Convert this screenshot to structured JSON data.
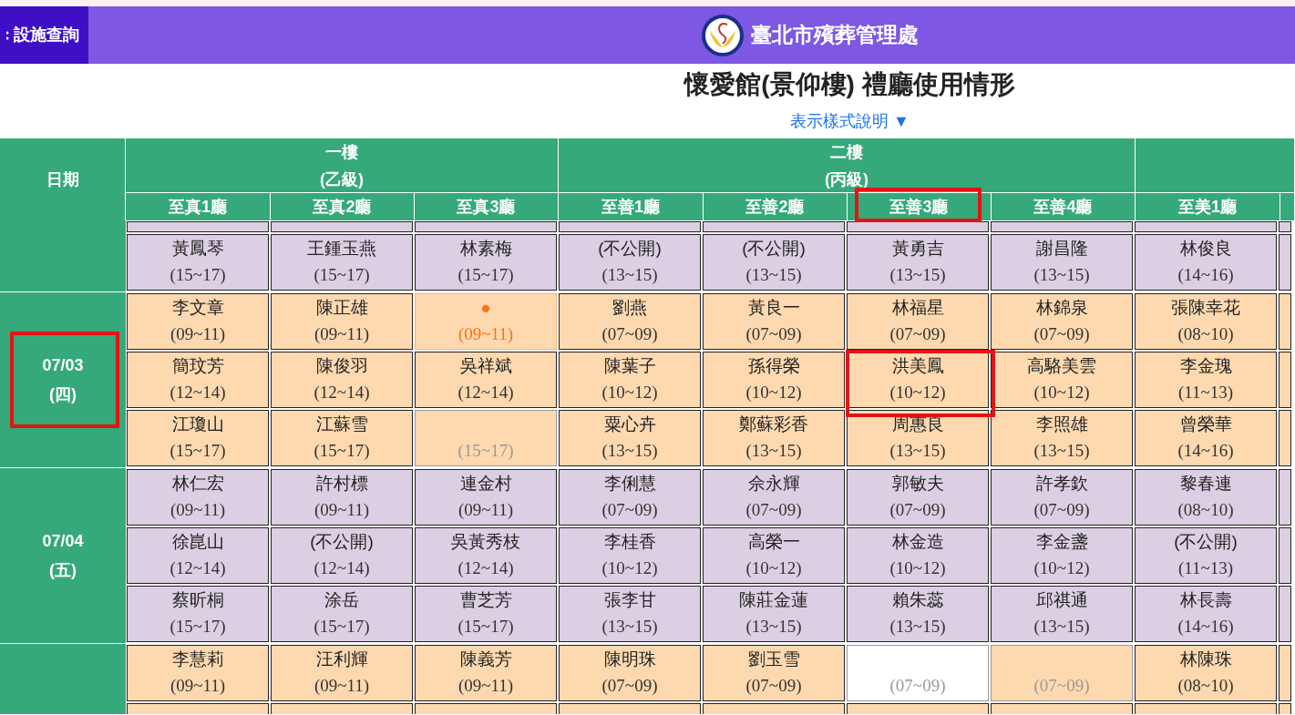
{
  "nav_button": {
    "label": "設施查詢"
  },
  "site_title": "臺北市殯葬管理處",
  "page_title": "懷愛館(景仰樓) 禮廳使用情形",
  "legend_link": "表示樣式說明 ▼",
  "table": {
    "date_heading": "日期",
    "floors": [
      {
        "name": "一樓",
        "grade": "(乙級)",
        "halls": [
          {
            "name": "至真1廳",
            "highlighted": false
          },
          {
            "name": "至真2廳",
            "highlighted": false
          },
          {
            "name": "至真3廳",
            "highlighted": false
          }
        ]
      },
      {
        "name": "二樓",
        "grade": "(丙級)",
        "halls": [
          {
            "name": "至善1廳",
            "highlighted": false
          },
          {
            "name": "至善2廳",
            "highlighted": false
          },
          {
            "name": "至善3廳",
            "highlighted": true
          },
          {
            "name": "至善4廳",
            "highlighted": false
          }
        ]
      },
      {
        "halls": [
          {
            "name": "至美1廳",
            "highlighted": false
          }
        ]
      }
    ],
    "days": [
      {
        "color": "#dccfe3",
        "highlighted": false,
        "rows": [
          [
            {
              "kind": "booked",
              "name": "黃鳳琴",
              "time": "(15~17)"
            },
            {
              "kind": "booked",
              "name": "王鍾玉燕",
              "time": "(15~17)"
            },
            {
              "kind": "booked",
              "name": "林素梅",
              "time": "(15~17)"
            },
            {
              "kind": "booked",
              "name": "(不公開)",
              "time": "(13~15)"
            },
            {
              "kind": "booked",
              "name": "(不公開)",
              "time": "(13~15)"
            },
            {
              "kind": "booked",
              "name": "黃勇吉",
              "time": "(13~15)"
            },
            {
              "kind": "booked",
              "name": "謝昌隆",
              "time": "(13~15)"
            },
            {
              "kind": "booked",
              "name": "林俊良",
              "time": "(14~16)"
            }
          ]
        ]
      },
      {
        "date": "07/03",
        "weekday": "(四)",
        "color": "#fed9b0",
        "highlighted": true,
        "rows": [
          [
            {
              "kind": "booked",
              "name": "李文章",
              "time": "(09~11)"
            },
            {
              "kind": "booked",
              "name": "陳正雄",
              "time": "(09~11)"
            },
            {
              "kind": "pending",
              "name": "●",
              "time": "(09~11)"
            },
            {
              "kind": "booked",
              "name": "劉燕",
              "time": "(07~09)"
            },
            {
              "kind": "booked",
              "name": "黃良一",
              "time": "(07~09)"
            },
            {
              "kind": "booked",
              "name": "林福星",
              "time": "(07~09)"
            },
            {
              "kind": "booked",
              "name": "林錦泉",
              "time": "(07~09)"
            },
            {
              "kind": "booked",
              "name": "張陳幸花",
              "time": "(08~10)"
            }
          ],
          [
            {
              "kind": "booked",
              "name": "簡玟芳",
              "time": "(12~14)"
            },
            {
              "kind": "booked",
              "name": "陳俊羽",
              "time": "(12~14)"
            },
            {
              "kind": "booked",
              "name": "吳祥斌",
              "time": "(12~14)"
            },
            {
              "kind": "booked",
              "name": "陳葉子",
              "time": "(10~12)"
            },
            {
              "kind": "booked",
              "name": "孫得榮",
              "time": "(10~12)"
            },
            {
              "kind": "booked",
              "name": "洪美鳳",
              "time": "(10~12)",
              "highlighted": true
            },
            {
              "kind": "booked",
              "name": "高駱美雲",
              "time": "(10~12)"
            },
            {
              "kind": "booked",
              "name": "李金瑰",
              "time": "(11~13)"
            }
          ],
          [
            {
              "kind": "booked",
              "name": "江瓊山",
              "time": "(15~17)"
            },
            {
              "kind": "booked",
              "name": "江蘇雪",
              "time": "(15~17)"
            },
            {
              "kind": "free",
              "time": "(15~17)"
            },
            {
              "kind": "booked",
              "name": "粟心卉",
              "time": "(13~15)"
            },
            {
              "kind": "booked",
              "name": "鄭蘇彩香",
              "time": "(13~15)"
            },
            {
              "kind": "booked",
              "name": "周惠良",
              "time": "(13~15)"
            },
            {
              "kind": "booked",
              "name": "李照雄",
              "time": "(13~15)"
            },
            {
              "kind": "booked",
              "name": "曾榮華",
              "time": "(14~16)"
            }
          ]
        ]
      },
      {
        "date": "07/04",
        "weekday": "(五)",
        "color": "#dccfe3",
        "highlighted": false,
        "rows": [
          [
            {
              "kind": "booked",
              "name": "林仁宏",
              "time": "(09~11)"
            },
            {
              "kind": "booked",
              "name": "許村標",
              "time": "(09~11)"
            },
            {
              "kind": "booked",
              "name": "連金村",
              "time": "(09~11)"
            },
            {
              "kind": "booked",
              "name": "李俐慧",
              "time": "(07~09)"
            },
            {
              "kind": "booked",
              "name": "佘永輝",
              "time": "(07~09)"
            },
            {
              "kind": "booked",
              "name": "郭敏夫",
              "time": "(07~09)"
            },
            {
              "kind": "booked",
              "name": "許孝欽",
              "time": "(07~09)"
            },
            {
              "kind": "booked",
              "name": "黎春連",
              "time": "(08~10)"
            }
          ],
          [
            {
              "kind": "booked",
              "name": "徐崑山",
              "time": "(12~14)"
            },
            {
              "kind": "booked",
              "name": "(不公開)",
              "time": "(12~14)"
            },
            {
              "kind": "booked",
              "name": "吳黃秀枝",
              "time": "(12~14)"
            },
            {
              "kind": "booked",
              "name": "李桂香",
              "time": "(10~12)"
            },
            {
              "kind": "booked",
              "name": "高榮一",
              "time": "(10~12)"
            },
            {
              "kind": "booked",
              "name": "林金造",
              "time": "(10~12)"
            },
            {
              "kind": "booked",
              "name": "李金盞",
              "time": "(10~12)"
            },
            {
              "kind": "booked",
              "name": "(不公開)",
              "time": "(11~13)"
            }
          ],
          [
            {
              "kind": "booked",
              "name": "蔡昕桐",
              "time": "(15~17)"
            },
            {
              "kind": "booked",
              "name": "涂岳",
              "time": "(15~17)"
            },
            {
              "kind": "booked",
              "name": "曹芝芳",
              "time": "(15~17)"
            },
            {
              "kind": "booked",
              "name": "張李甘",
              "time": "(13~15)"
            },
            {
              "kind": "booked",
              "name": "陳莊金蓮",
              "time": "(13~15)"
            },
            {
              "kind": "booked",
              "name": "賴朱蕊",
              "time": "(13~15)"
            },
            {
              "kind": "booked",
              "name": "邱祺通",
              "time": "(13~15)"
            },
            {
              "kind": "booked",
              "name": "林長壽",
              "time": "(14~16)"
            }
          ]
        ]
      },
      {
        "color": "#fed9b0",
        "highlighted": false,
        "rows": [
          [
            {
              "kind": "booked",
              "name": "李慧莉",
              "time": "(09~11)"
            },
            {
              "kind": "booked",
              "name": "汪利輝",
              "time": "(09~11)"
            },
            {
              "kind": "booked",
              "name": "陳義芳",
              "time": "(09~11)"
            },
            {
              "kind": "booked",
              "name": "陳明珠",
              "time": "(07~09)"
            },
            {
              "kind": "booked",
              "name": "劉玉雪",
              "time": "(07~09)"
            },
            {
              "kind": "vacant",
              "time": "(07~09)"
            },
            {
              "kind": "free",
              "time": "(07~09)"
            },
            {
              "kind": "booked",
              "name": "林陳珠",
              "time": "(08~10)"
            }
          ]
        ]
      }
    ]
  }
}
